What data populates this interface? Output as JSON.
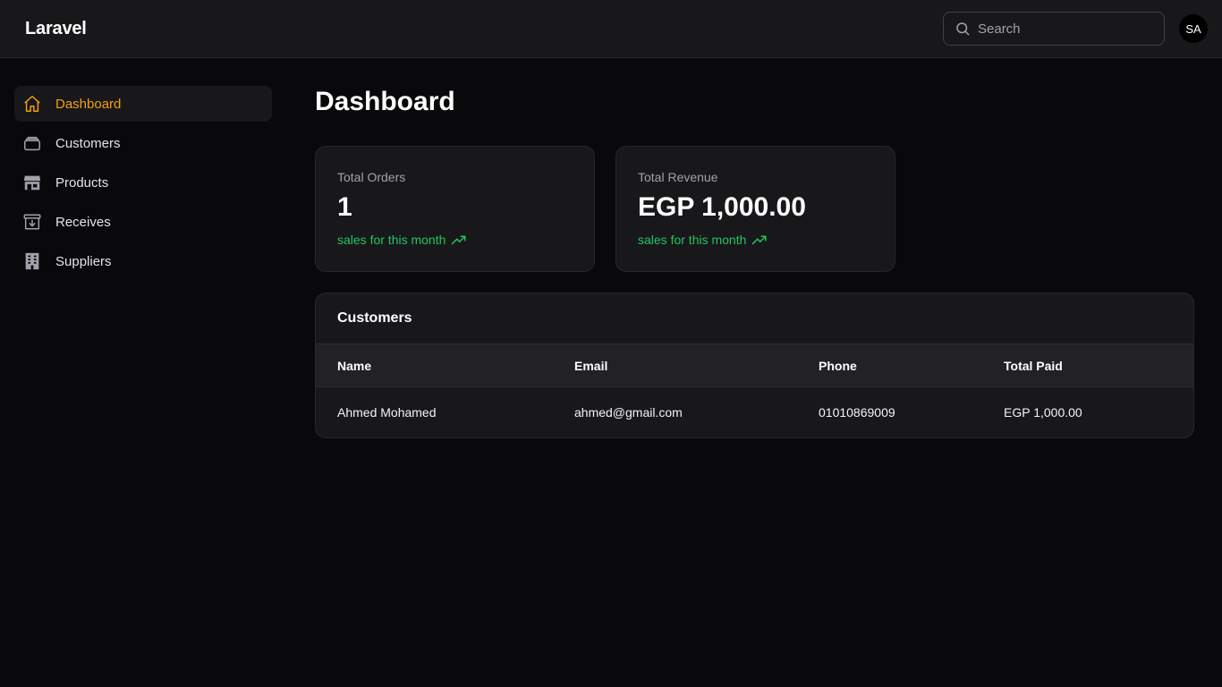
{
  "app": {
    "brand": "Laravel"
  },
  "search": {
    "placeholder": "Search"
  },
  "user": {
    "initials": "SA"
  },
  "colors": {
    "accent": "#f59e0b",
    "trend": "#22c55e",
    "background": "#09090b",
    "card": "#18181b"
  },
  "sidebar": {
    "items": [
      {
        "label": "Dashboard",
        "icon": "home-icon",
        "active": true
      },
      {
        "label": "Customers",
        "icon": "stack-icon",
        "active": false
      },
      {
        "label": "Products",
        "icon": "store-icon",
        "active": false
      },
      {
        "label": "Receives",
        "icon": "archive-in-icon",
        "active": false
      },
      {
        "label": "Suppliers",
        "icon": "building-icon",
        "active": false
      }
    ]
  },
  "main": {
    "title": "Dashboard",
    "stats": [
      {
        "label": "Total Orders",
        "value": "1",
        "trend": "sales for this month",
        "trend_icon": "trending-up-icon"
      },
      {
        "label": "Total Revenue",
        "value": "EGP 1,000.00",
        "trend": "sales for this month",
        "trend_icon": "trending-up-icon"
      }
    ],
    "customers_table": {
      "title": "Customers",
      "columns": [
        "Name",
        "Email",
        "Phone",
        "Total Paid"
      ],
      "rows": [
        [
          "Ahmed Mohamed",
          "ahmed@gmail.com",
          "01010869009",
          "EGP 1,000.00"
        ]
      ]
    }
  }
}
